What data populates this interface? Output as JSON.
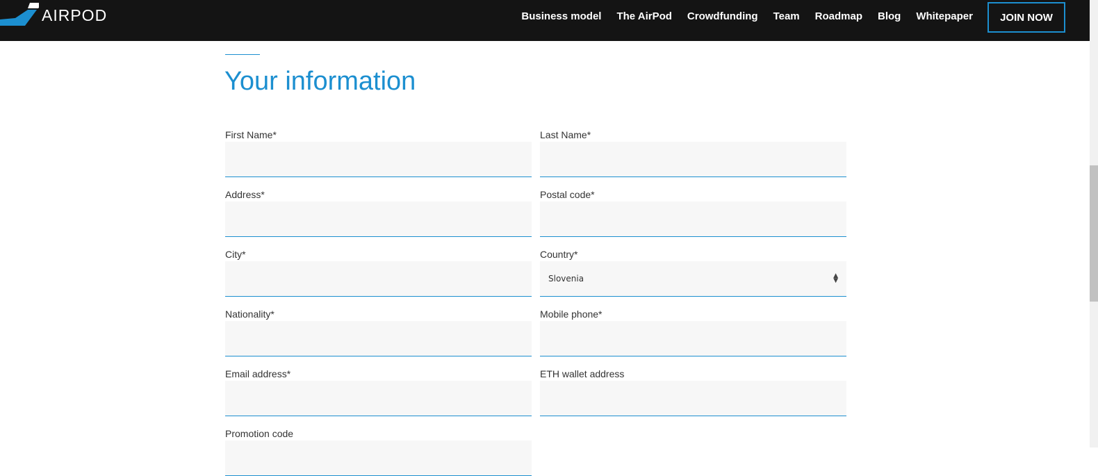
{
  "brand": {
    "name": "AIRPOD"
  },
  "nav": {
    "items": [
      "Business model",
      "The AirPod",
      "Crowdfunding",
      "Team",
      "Roadmap",
      "Blog",
      "Whitepaper"
    ],
    "join": "JOIN NOW"
  },
  "form": {
    "title": "Your information",
    "fields": [
      {
        "label": "First Name*",
        "value": ""
      },
      {
        "label": "Last Name*",
        "value": ""
      },
      {
        "label": "Address*",
        "value": ""
      },
      {
        "label": "Postal code*",
        "value": ""
      },
      {
        "label": "City*",
        "value": ""
      },
      {
        "label": "Country*",
        "value": "Slovenia"
      },
      {
        "label": "Nationality*",
        "value": ""
      },
      {
        "label": "Mobile phone*",
        "value": ""
      },
      {
        "label": "Email address*",
        "value": ""
      },
      {
        "label": "ETH wallet address",
        "value": ""
      },
      {
        "label": "Promotion code",
        "value": ""
      }
    ]
  },
  "colors": {
    "accent": "#1c8fd0",
    "nav_bg": "#141414"
  }
}
